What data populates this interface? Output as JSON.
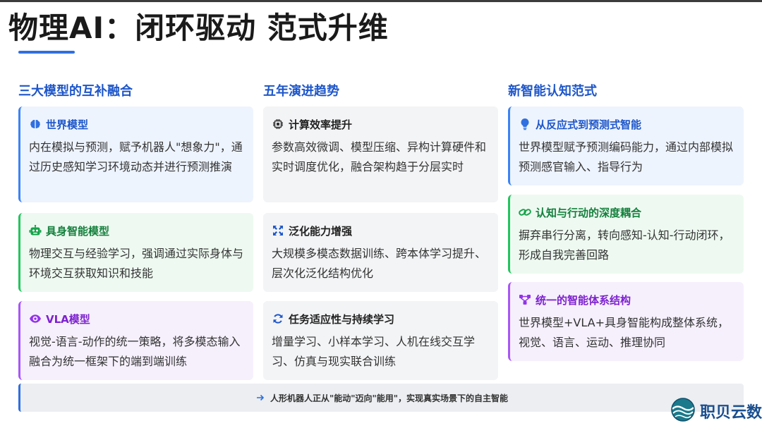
{
  "page": {
    "title": "物理AI：闭环驱动 范式升维"
  },
  "columns": [
    {
      "title": "三大模型的互补融合",
      "cards": [
        {
          "icon": "brain-icon",
          "title": "世界模型",
          "desc": "内在模拟与预测，赋予机器人\"想象力\"，通过历史感知学习环境动态并进行预测推演"
        },
        {
          "icon": "robot-icon",
          "title": "具身智能模型",
          "desc": "物理交互与经验学习，强调通过实际身体与环境交互获取知识和技能"
        },
        {
          "icon": "eye-icon",
          "title": "VLA模型",
          "desc": "视觉-语言-动作的统一策略，将多模态输入融合为统一框架下的端到端训练"
        }
      ]
    },
    {
      "title": "五年演进趋势",
      "cards": [
        {
          "icon": "chip-icon",
          "title": "计算效率提升",
          "desc": "参数高效微调、模型压缩、异构计算硬件和实时调度优化，融合架构趋于分层实时"
        },
        {
          "icon": "expand-icon",
          "title": "泛化能力增强",
          "desc": "大规模多模态数据训练、跨本体学习提升、层次化泛化结构优化"
        },
        {
          "icon": "sync-icon",
          "title": "任务适应性与持续学习",
          "desc": "增量学习、小样本学习、人机在线交互学习、仿真与现实联合训练"
        }
      ]
    },
    {
      "title": "新智能认知范式",
      "cards": [
        {
          "icon": "lightbulb-icon",
          "title": "从反应式到预测式智能",
          "desc": "世界模型赋予预测编码能力，通过内部模拟预测感官输入、指导行为"
        },
        {
          "icon": "link-icon",
          "title": "认知与行动的深度耦合",
          "desc": "摒弃串行分离，转向感知-认知-行动闭环，形成自我完善回路"
        },
        {
          "icon": "hierarchy-icon",
          "title": "统一的智能体系结构",
          "desc": "世界模型+VLA+具身智能构成整体系统，视觉、语言、运动、推理协同"
        }
      ]
    }
  ],
  "footer": {
    "icon": "arrow-right-icon",
    "text": "人形机器人正从\"能动\"迈向\"能用\"，实现真实场景下的自主智能"
  },
  "brand": {
    "name": "职贝云数"
  },
  "colors": {
    "accent_blue": "#2f6fe0",
    "green": "#22c55e",
    "purple": "#a855f7"
  }
}
